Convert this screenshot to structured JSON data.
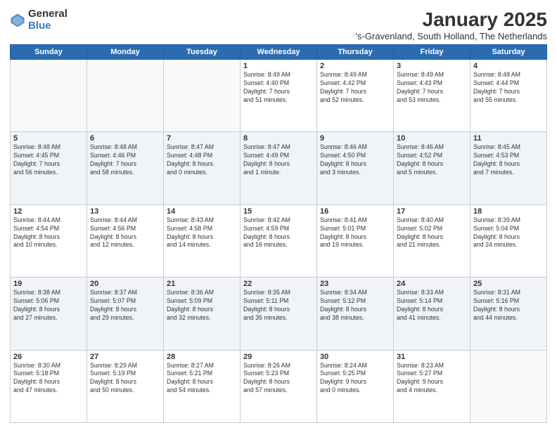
{
  "logo": {
    "general": "General",
    "blue": "Blue"
  },
  "title": "January 2025",
  "subtitle": "'s-Gravenland, South Holland, The Netherlands",
  "days_header": [
    "Sunday",
    "Monday",
    "Tuesday",
    "Wednesday",
    "Thursday",
    "Friday",
    "Saturday"
  ],
  "weeks": [
    [
      {
        "day": "",
        "info": ""
      },
      {
        "day": "",
        "info": ""
      },
      {
        "day": "",
        "info": ""
      },
      {
        "day": "1",
        "info": "Sunrise: 8:49 AM\nSunset: 4:40 PM\nDaylight: 7 hours\nand 51 minutes."
      },
      {
        "day": "2",
        "info": "Sunrise: 8:49 AM\nSunset: 4:42 PM\nDaylight: 7 hours\nand 52 minutes."
      },
      {
        "day": "3",
        "info": "Sunrise: 8:49 AM\nSunset: 4:43 PM\nDaylight: 7 hours\nand 53 minutes."
      },
      {
        "day": "4",
        "info": "Sunrise: 8:48 AM\nSunset: 4:44 PM\nDaylight: 7 hours\nand 55 minutes."
      }
    ],
    [
      {
        "day": "5",
        "info": "Sunrise: 8:48 AM\nSunset: 4:45 PM\nDaylight: 7 hours\nand 56 minutes."
      },
      {
        "day": "6",
        "info": "Sunrise: 8:48 AM\nSunset: 4:46 PM\nDaylight: 7 hours\nand 58 minutes."
      },
      {
        "day": "7",
        "info": "Sunrise: 8:47 AM\nSunset: 4:48 PM\nDaylight: 8 hours\nand 0 minutes."
      },
      {
        "day": "8",
        "info": "Sunrise: 8:47 AM\nSunset: 4:49 PM\nDaylight: 8 hours\nand 1 minute."
      },
      {
        "day": "9",
        "info": "Sunrise: 8:46 AM\nSunset: 4:50 PM\nDaylight: 8 hours\nand 3 minutes."
      },
      {
        "day": "10",
        "info": "Sunrise: 8:46 AM\nSunset: 4:52 PM\nDaylight: 8 hours\nand 5 minutes."
      },
      {
        "day": "11",
        "info": "Sunrise: 8:45 AM\nSunset: 4:53 PM\nDaylight: 8 hours\nand 7 minutes."
      }
    ],
    [
      {
        "day": "12",
        "info": "Sunrise: 8:44 AM\nSunset: 4:54 PM\nDaylight: 8 hours\nand 10 minutes."
      },
      {
        "day": "13",
        "info": "Sunrise: 8:44 AM\nSunset: 4:56 PM\nDaylight: 8 hours\nand 12 minutes."
      },
      {
        "day": "14",
        "info": "Sunrise: 8:43 AM\nSunset: 4:58 PM\nDaylight: 8 hours\nand 14 minutes."
      },
      {
        "day": "15",
        "info": "Sunrise: 8:42 AM\nSunset: 4:59 PM\nDaylight: 8 hours\nand 16 minutes."
      },
      {
        "day": "16",
        "info": "Sunrise: 8:41 AM\nSunset: 5:01 PM\nDaylight: 8 hours\nand 19 minutes."
      },
      {
        "day": "17",
        "info": "Sunrise: 8:40 AM\nSunset: 5:02 PM\nDaylight: 8 hours\nand 21 minutes."
      },
      {
        "day": "18",
        "info": "Sunrise: 8:39 AM\nSunset: 5:04 PM\nDaylight: 8 hours\nand 24 minutes."
      }
    ],
    [
      {
        "day": "19",
        "info": "Sunrise: 8:38 AM\nSunset: 5:06 PM\nDaylight: 8 hours\nand 27 minutes."
      },
      {
        "day": "20",
        "info": "Sunrise: 8:37 AM\nSunset: 5:07 PM\nDaylight: 8 hours\nand 29 minutes."
      },
      {
        "day": "21",
        "info": "Sunrise: 8:36 AM\nSunset: 5:09 PM\nDaylight: 8 hours\nand 32 minutes."
      },
      {
        "day": "22",
        "info": "Sunrise: 8:35 AM\nSunset: 5:11 PM\nDaylight: 8 hours\nand 35 minutes."
      },
      {
        "day": "23",
        "info": "Sunrise: 8:34 AM\nSunset: 5:12 PM\nDaylight: 8 hours\nand 38 minutes."
      },
      {
        "day": "24",
        "info": "Sunrise: 8:33 AM\nSunset: 5:14 PM\nDaylight: 8 hours\nand 41 minutes."
      },
      {
        "day": "25",
        "info": "Sunrise: 8:31 AM\nSunset: 5:16 PM\nDaylight: 8 hours\nand 44 minutes."
      }
    ],
    [
      {
        "day": "26",
        "info": "Sunrise: 8:30 AM\nSunset: 5:18 PM\nDaylight: 8 hours\nand 47 minutes."
      },
      {
        "day": "27",
        "info": "Sunrise: 8:29 AM\nSunset: 5:19 PM\nDaylight: 8 hours\nand 50 minutes."
      },
      {
        "day": "28",
        "info": "Sunrise: 8:27 AM\nSunset: 5:21 PM\nDaylight: 8 hours\nand 54 minutes."
      },
      {
        "day": "29",
        "info": "Sunrise: 8:26 AM\nSunset: 5:23 PM\nDaylight: 8 hours\nand 57 minutes."
      },
      {
        "day": "30",
        "info": "Sunrise: 8:24 AM\nSunset: 5:25 PM\nDaylight: 9 hours\nand 0 minutes."
      },
      {
        "day": "31",
        "info": "Sunrise: 8:23 AM\nSunset: 5:27 PM\nDaylight: 9 hours\nand 4 minutes."
      },
      {
        "day": "",
        "info": ""
      }
    ]
  ]
}
